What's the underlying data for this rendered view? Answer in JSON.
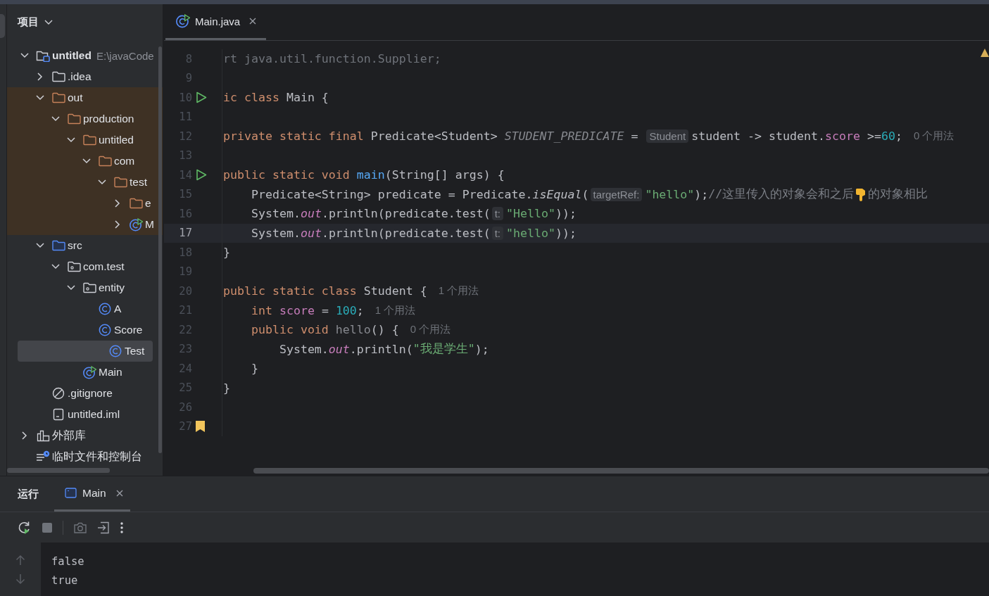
{
  "project_panel": {
    "title": "项目",
    "tree": [
      {
        "label": "untitled",
        "kind": "project",
        "path": "E:\\javaCode",
        "expanded": true,
        "selected": false,
        "excluded": false,
        "children": [
          {
            "label": ".idea",
            "kind": "folder",
            "expanded": false,
            "selected": false,
            "excluded": false
          },
          {
            "label": "out",
            "kind": "folder",
            "expanded": true,
            "selected": false,
            "excluded": true,
            "children": [
              {
                "label": "production",
                "kind": "folder",
                "expanded": true,
                "selected": false,
                "excluded": true,
                "children": [
                  {
                    "label": "untitled",
                    "kind": "folder",
                    "expanded": true,
                    "selected": false,
                    "excluded": true,
                    "children": [
                      {
                        "label": "com",
                        "kind": "folder",
                        "expanded": true,
                        "selected": false,
                        "excluded": true,
                        "children": [
                          {
                            "label": "test",
                            "kind": "folder",
                            "expanded": true,
                            "selected": false,
                            "excluded": true,
                            "children": [
                              {
                                "label": "e",
                                "kind": "folder",
                                "expanded": false,
                                "selected": false,
                                "excluded": true
                              },
                              {
                                "label": "M",
                                "kind": "main-class",
                                "expanded": false,
                                "selected": false,
                                "excluded": true
                              }
                            ]
                          }
                        ]
                      }
                    ]
                  }
                ]
              }
            ]
          },
          {
            "label": "src",
            "kind": "source-folder",
            "expanded": true,
            "selected": false,
            "excluded": false,
            "children": [
              {
                "label": "com.test",
                "kind": "package",
                "expanded": true,
                "selected": false,
                "excluded": false,
                "children": [
                  {
                    "label": "entity",
                    "kind": "package",
                    "expanded": true,
                    "selected": false,
                    "excluded": false,
                    "children": [
                      {
                        "label": "A",
                        "kind": "class",
                        "selected": false,
                        "excluded": false
                      },
                      {
                        "label": "Score",
                        "kind": "class",
                        "selected": false,
                        "excluded": false
                      },
                      {
                        "label": "Test",
                        "kind": "class",
                        "selected": true,
                        "excluded": false
                      }
                    ]
                  },
                  {
                    "label": "Main",
                    "kind": "main-class",
                    "selected": false,
                    "excluded": false
                  }
                ]
              }
            ]
          },
          {
            "label": ".gitignore",
            "kind": "ignore-file",
            "selected": false,
            "excluded": false
          },
          {
            "label": "untitled.iml",
            "kind": "module-file",
            "selected": false,
            "excluded": false
          }
        ]
      },
      {
        "label": "外部库",
        "kind": "library",
        "expanded": false,
        "selected": false,
        "excluded": false
      },
      {
        "label": "临时文件和控制台",
        "kind": "scratch",
        "selected": false,
        "excluded": false
      }
    ]
  },
  "editor": {
    "tabs": [
      {
        "label": "Main.java",
        "selected": true
      }
    ],
    "lines": [
      {
        "number": "8",
        "current": false,
        "tokens": [
          {
            "kind": "dim",
            "text": "rt java.util.function.Supplier;"
          }
        ]
      },
      {
        "number": "9",
        "current": false
      },
      {
        "number": "10",
        "current": false,
        "gutter": {
          "kind": "run"
        },
        "tokens": [
          {
            "kind": "kw",
            "text": "ic class "
          },
          {
            "kind": "plain",
            "text": "Main {"
          }
        ]
      },
      {
        "number": "11",
        "current": false
      },
      {
        "number": "12",
        "current": false,
        "tokens": [
          {
            "kind": "kw",
            "text": "private static final "
          },
          {
            "kind": "plain",
            "text": "Predicate<Student> "
          },
          {
            "kind": "const",
            "text": "STUDENT_PREDICATE"
          },
          {
            "kind": "plain",
            "text": " = "
          },
          {
            "kind": "hint",
            "text": "Student"
          },
          {
            "kind": "plain",
            "text": "student -> student."
          },
          {
            "kind": "field",
            "text": "score"
          },
          {
            "kind": "plain",
            "text": " >="
          },
          {
            "kind": "num",
            "text": "60"
          },
          {
            "kind": "plain",
            "text": ";"
          },
          {
            "kind": "usage",
            "text": "0 个用法"
          }
        ]
      },
      {
        "number": "13",
        "current": false
      },
      {
        "number": "14",
        "current": false,
        "gutter": {
          "kind": "run"
        },
        "tokens": [
          {
            "kind": "kw",
            "text": "public static void "
          },
          {
            "kind": "fn",
            "text": "main"
          },
          {
            "kind": "plain",
            "text": "(String[] args) {"
          }
        ]
      },
      {
        "number": "15",
        "current": false,
        "tokens": [
          {
            "kind": "plain",
            "text": "    Predicate<String> predicate = Predicate."
          },
          {
            "kind": "italic",
            "text": "isEqual"
          },
          {
            "kind": "plain",
            "text": "("
          },
          {
            "kind": "hint",
            "text": "targetRef:"
          },
          {
            "kind": "str",
            "text": "\"hello\""
          },
          {
            "kind": "plain",
            "text": ");"
          },
          {
            "kind": "comment",
            "text": "//这里传入的对象会和之后"
          },
          {
            "kind": "hand"
          },
          {
            "kind": "comment",
            "text": "的对象相比"
          }
        ]
      },
      {
        "number": "16",
        "current": false,
        "tokens": [
          {
            "kind": "plain",
            "text": "    System."
          },
          {
            "kind": "static",
            "text": "out"
          },
          {
            "kind": "plain",
            "text": ".println(predicate.test("
          },
          {
            "kind": "hint",
            "text": "t:"
          },
          {
            "kind": "str",
            "text": "\"Hello\""
          },
          {
            "kind": "plain",
            "text": "));"
          }
        ]
      },
      {
        "number": "17",
        "current": true,
        "tokens": [
          {
            "kind": "plain",
            "text": "    System."
          },
          {
            "kind": "static",
            "text": "out"
          },
          {
            "kind": "plain",
            "text": ".println(predicate.test("
          },
          {
            "kind": "hint",
            "text": "t:"
          },
          {
            "kind": "str",
            "text": "\"hello\""
          },
          {
            "kind": "plain",
            "text": "));"
          }
        ]
      },
      {
        "number": "18",
        "current": false,
        "tokens": [
          {
            "kind": "plain",
            "text": "}"
          }
        ]
      },
      {
        "number": "19",
        "current": false
      },
      {
        "number": "20",
        "current": false,
        "tokens": [
          {
            "kind": "kw",
            "text": "public static class "
          },
          {
            "kind": "plain",
            "text": "Student {"
          },
          {
            "kind": "usage",
            "text": "1 个用法"
          }
        ]
      },
      {
        "number": "21",
        "current": false,
        "tokens": [
          {
            "kind": "kw",
            "text": "    int "
          },
          {
            "kind": "field",
            "text": "score"
          },
          {
            "kind": "plain",
            "text": " = "
          },
          {
            "kind": "num",
            "text": "100"
          },
          {
            "kind": "plain",
            "text": ";"
          },
          {
            "kind": "usage",
            "text": "1 个用法"
          }
        ]
      },
      {
        "number": "22",
        "current": false,
        "tokens": [
          {
            "kind": "kw",
            "text": "    public void "
          },
          {
            "kind": "unused",
            "text": "hello"
          },
          {
            "kind": "plain",
            "text": "() {"
          },
          {
            "kind": "usage",
            "text": "0 个用法"
          }
        ]
      },
      {
        "number": "23",
        "current": false,
        "tokens": [
          {
            "kind": "plain",
            "text": "        System."
          },
          {
            "kind": "static",
            "text": "out"
          },
          {
            "kind": "plain",
            "text": ".println("
          },
          {
            "kind": "str",
            "text": "\"我是学生\""
          },
          {
            "kind": "plain",
            "text": ");"
          }
        ]
      },
      {
        "number": "24",
        "current": false,
        "tokens": [
          {
            "kind": "plain",
            "text": "    }"
          }
        ]
      },
      {
        "number": "25",
        "current": false,
        "tokens": [
          {
            "kind": "plain",
            "text": "}"
          }
        ]
      },
      {
        "number": "26",
        "current": false
      },
      {
        "number": "27",
        "current": false,
        "gutter": {
          "kind": "bookmark"
        }
      }
    ]
  },
  "run_panel": {
    "title": "运行",
    "tabs": [
      {
        "label": "Main",
        "selected": true
      }
    ],
    "console": [
      "false",
      "true"
    ]
  }
}
